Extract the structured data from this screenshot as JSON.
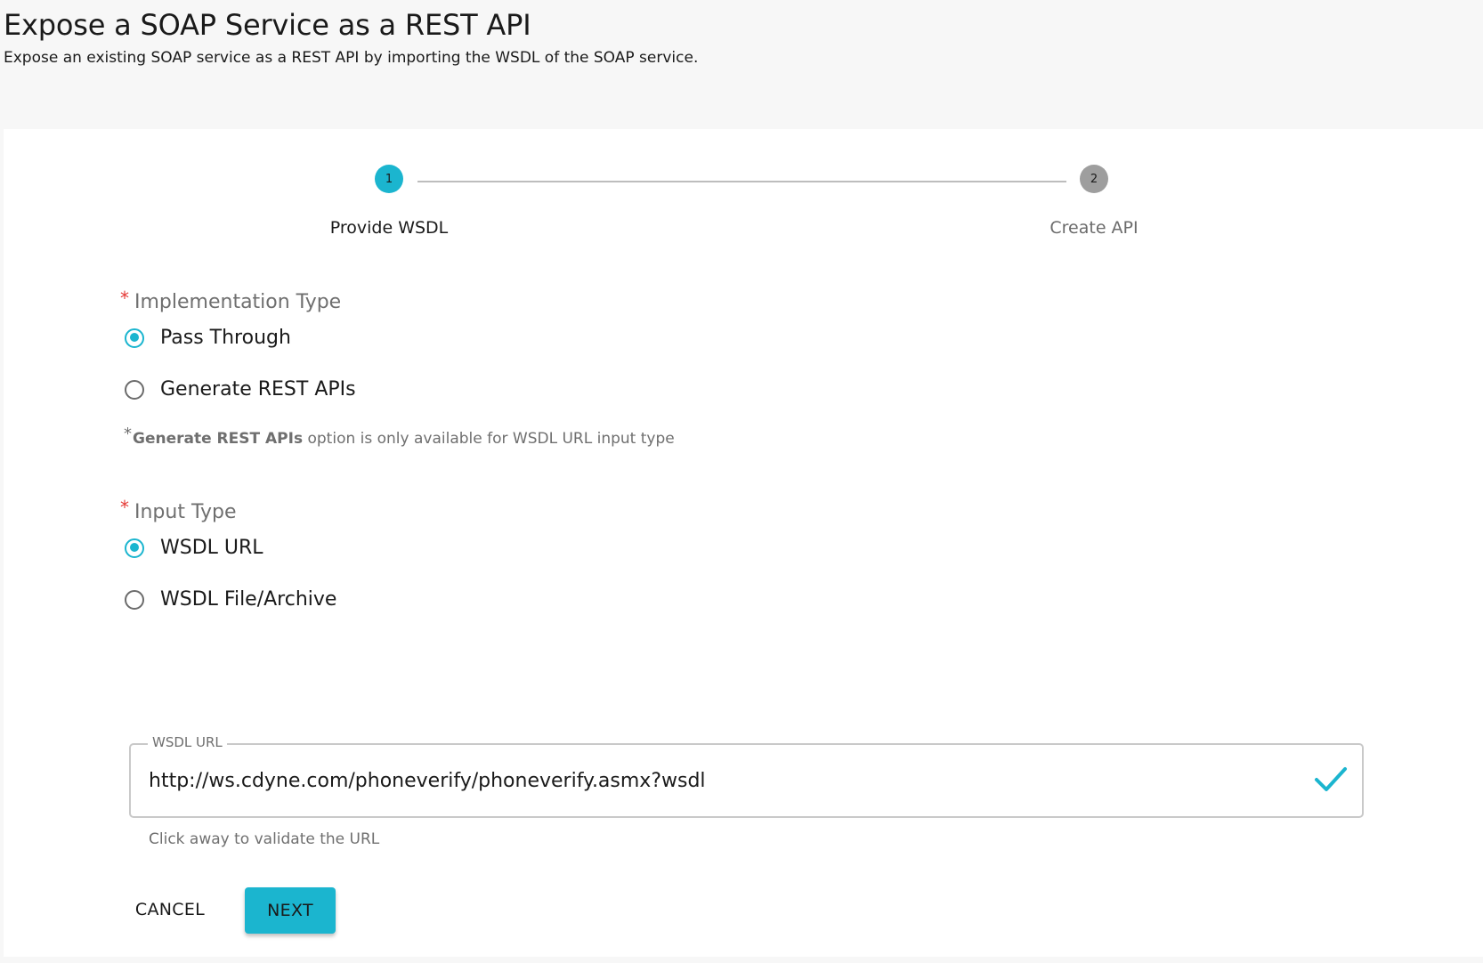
{
  "header": {
    "title": "Expose a SOAP Service as a REST API",
    "subtitle": "Expose an existing SOAP service as a REST API by importing the WSDL of the SOAP service."
  },
  "stepper": {
    "steps": [
      {
        "number": "1",
        "label": "Provide WSDL",
        "state": "active"
      },
      {
        "number": "2",
        "label": "Create API",
        "state": "inactive"
      }
    ]
  },
  "form": {
    "implementation_type": {
      "label": "Implementation Type",
      "required_marker": "*",
      "options": [
        {
          "label": "Pass Through",
          "selected": true
        },
        {
          "label": "Generate REST APIs",
          "selected": false
        }
      ],
      "note": {
        "marker": "*",
        "bold": "Generate REST APIs",
        "text": " option is only available for WSDL URL input type"
      }
    },
    "input_type": {
      "label": "Input Type",
      "required_marker": "*",
      "options": [
        {
          "label": "WSDL URL",
          "selected": true
        },
        {
          "label": "WSDL File/Archive",
          "selected": false
        }
      ]
    },
    "wsdl_url": {
      "legend": "WSDL URL",
      "value": "http://ws.cdyne.com/phoneverify/phoneverify.asmx?wsdl",
      "helper": "Click away to validate the URL",
      "valid_icon": "check-icon"
    }
  },
  "actions": {
    "cancel_label": "CANCEL",
    "next_label": "NEXT"
  },
  "colors": {
    "accent": "#1bb5cf",
    "required": "#e53935",
    "inactive_step": "#9e9e9e"
  }
}
